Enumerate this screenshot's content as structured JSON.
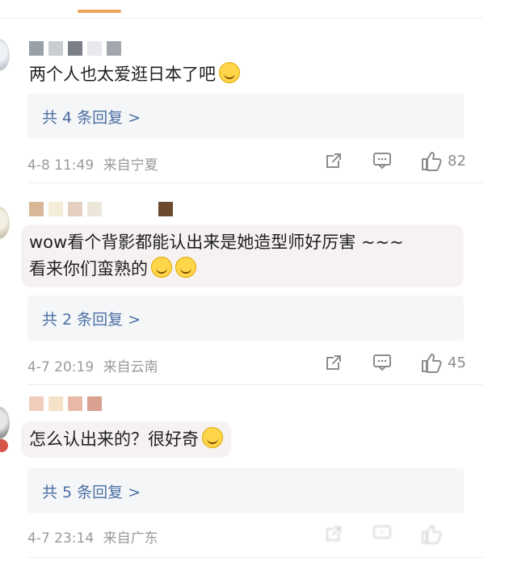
{
  "comments": [
    {
      "text": "两个人也太爱逛日本了吧",
      "replies": "共 4 条回复 >",
      "time": "4-8 11:49",
      "location": "来自宁夏",
      "likes": "82",
      "username_pixels": [
        "#9aa0a8",
        "#c9ccd1",
        "#7b8087",
        "#e7e9ec",
        "#a3a7ad"
      ]
    },
    {
      "text_line1": "wow看个背影都能认出来是她造型师好厉害 ~~~",
      "text_line2": "看来你们蛮熟的",
      "replies": "共 2 条回复 >",
      "time": "4-7 20:19",
      "location": "来自云南",
      "likes": "45",
      "username_pixels": [
        "#e4cfc0",
        "#f3ecd9",
        "#d8b898",
        "#ece6da",
        "#6b4a2e"
      ]
    },
    {
      "text": "怎么认出来的？很好奇",
      "replies": "共 5 条回复 >",
      "time": "4-7 23:14",
      "location": "来自广东",
      "username_pixels": [
        "#f1cdbd",
        "#f6e2c9",
        "#e8b9a6",
        "#d9a18f"
      ]
    }
  ],
  "icons": {
    "share": "share-icon",
    "comment": "comment-icon",
    "like": "thumbs-up-icon"
  }
}
